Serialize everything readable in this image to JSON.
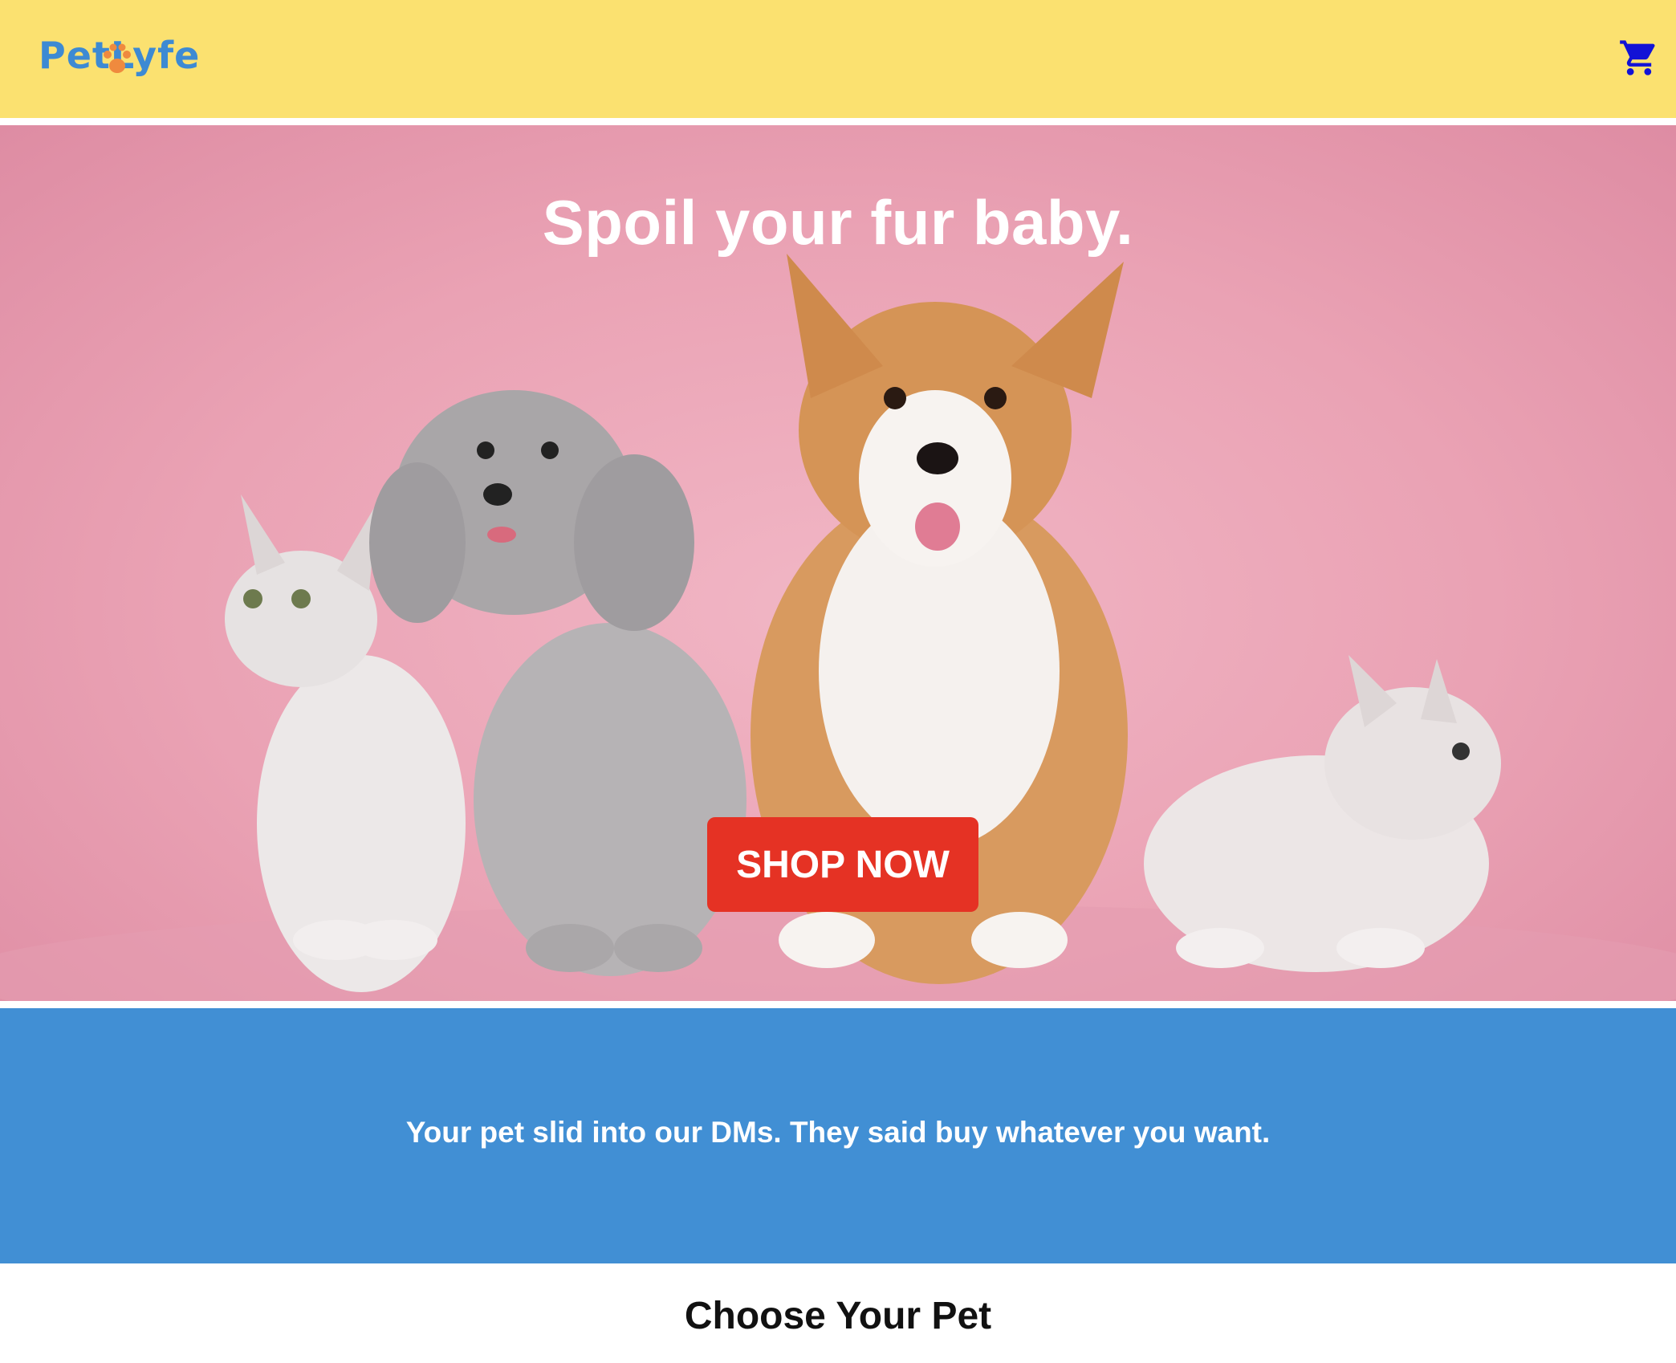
{
  "header": {
    "logo_text": "PetLyfe",
    "cart_icon": "shopping-cart-icon",
    "background": "#fbe170",
    "logo_color": "#3d8ad3",
    "paw_color": "#ef8a3e"
  },
  "hero": {
    "title": "Spoil your fur baby.",
    "cta_label": "SHOP NOW",
    "background": "#eaa2b4",
    "cta_color": "#e53224"
  },
  "promo": {
    "text": "Your pet slid into our DMs. They said buy whatever you want.",
    "background": "#418fd4"
  },
  "section": {
    "title": "Choose Your Pet"
  }
}
